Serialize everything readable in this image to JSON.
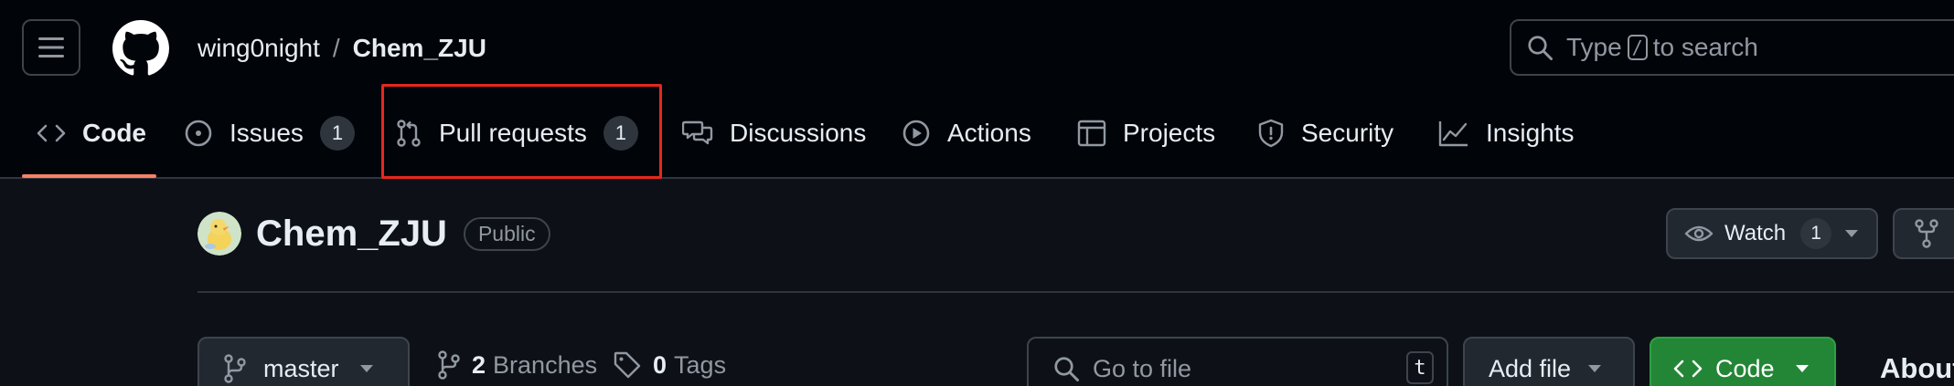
{
  "header": {
    "owner": "wing0night",
    "separator": "/",
    "repo": "Chem_ZJU",
    "search": {
      "prefix": "Type",
      "key": "/",
      "suffix": "to search"
    }
  },
  "tabs": [
    {
      "id": "code",
      "label": "Code",
      "icon": "code-icon",
      "active": true
    },
    {
      "id": "issues",
      "label": "Issues",
      "icon": "issue-icon",
      "count": "1"
    },
    {
      "id": "pulls",
      "label": "Pull requests",
      "icon": "pull-request-icon",
      "count": "1",
      "highlighted": true
    },
    {
      "id": "discussions",
      "label": "Discussions",
      "icon": "discussions-icon"
    },
    {
      "id": "actions",
      "label": "Actions",
      "icon": "play-icon"
    },
    {
      "id": "projects",
      "label": "Projects",
      "icon": "table-icon"
    },
    {
      "id": "security",
      "label": "Security",
      "icon": "shield-icon"
    },
    {
      "id": "insights",
      "label": "Insights",
      "icon": "graph-icon"
    }
  ],
  "repo": {
    "name": "Chem_ZJU",
    "visibility": "Public",
    "watch": {
      "label": "Watch",
      "count": "1"
    }
  },
  "toolbar": {
    "branch": "master",
    "branches": {
      "count": "2",
      "label": "Branches"
    },
    "tags": {
      "count": "0",
      "label": "Tags"
    },
    "goto": {
      "placeholder": "Go to file",
      "key": "t"
    },
    "add_file": "Add file",
    "code": "Code"
  },
  "sidebar": {
    "about": "About"
  },
  "colors": {
    "accent_underline": "#f78166",
    "code_button": "#238636",
    "highlight": "#e5281e"
  }
}
